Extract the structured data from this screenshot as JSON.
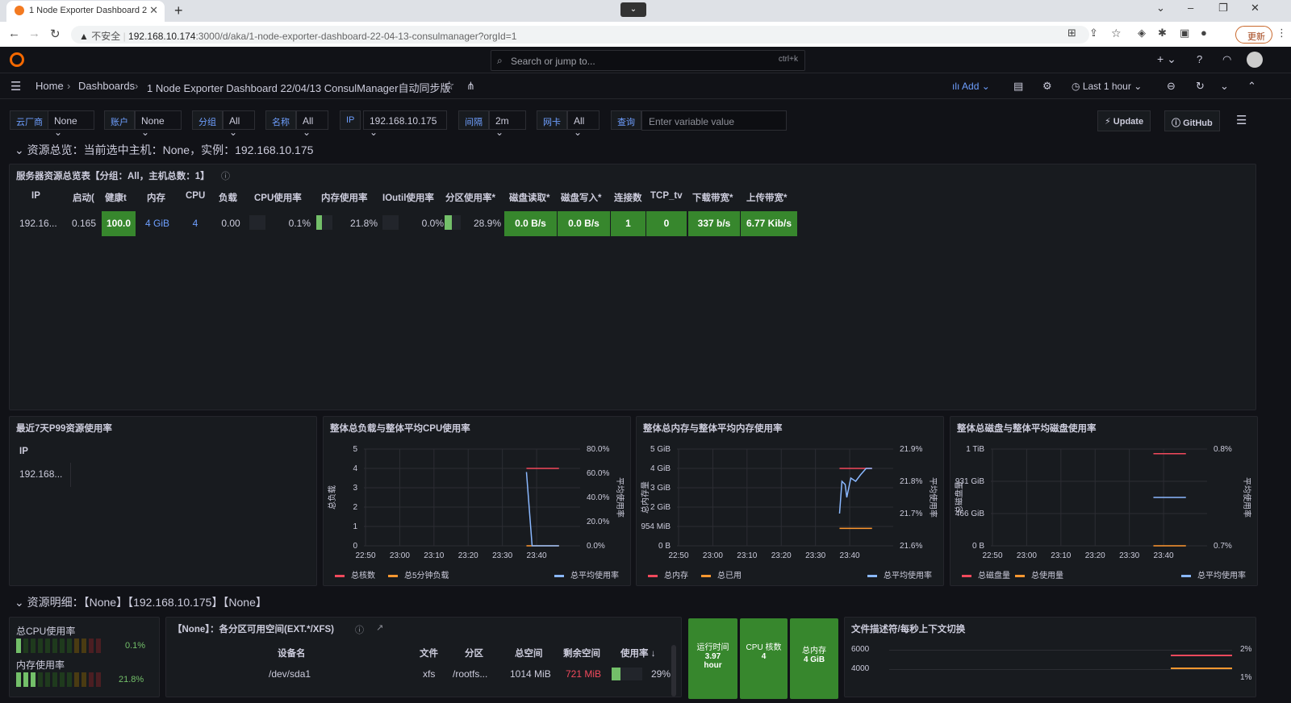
{
  "browser": {
    "tab_title": "1 Node Exporter Dashboard 2",
    "url_warning": "不安全",
    "url_host": "192.168.10.174",
    "url_rest": ":3000/d/aka/1-node-exporter-dashboard-22-04-13-consulmanager?orgId=1",
    "update_label": "更新"
  },
  "topbar": {
    "search_placeholder": "Search or jump to...",
    "shortcut": "ctrl+k"
  },
  "breadcrumb": {
    "home": "Home",
    "dashboards": "Dashboards",
    "title": "1 Node Exporter Dashboard 22/04/13 ConsulManager自动同步版"
  },
  "toolbar": {
    "add": "Add",
    "time_range": "Last 1 hour"
  },
  "variables": [
    {
      "label": "云厂商",
      "value": "None"
    },
    {
      "label": "账户",
      "value": "None"
    },
    {
      "label": "分组",
      "value": "All"
    },
    {
      "label": "名称",
      "value": "All"
    },
    {
      "label": "IP",
      "value": "192.168.10.175"
    },
    {
      "label": "间隔",
      "value": "2m"
    },
    {
      "label": "网卡",
      "value": "All"
    },
    {
      "label": "查询",
      "placeholder": "Enter variable value"
    }
  ],
  "buttons": {
    "update": "Update",
    "github": "GitHub"
  },
  "row1_title": "资源总览：当前选中主机：None，实例：192.168.10.175",
  "overview": {
    "title": "服务器资源总览表【分组：All，主机总数：1】",
    "headers": [
      "IP",
      "启动(",
      "健康t",
      "内存",
      "CPU",
      "负载",
      "CPU使用率",
      "内存使用率",
      "IOutil使用率",
      "分区使用率*",
      "磁盘读取*",
      "磁盘写入*",
      "连接数",
      "TCP_tv",
      "下载带宽*",
      "上传带宽*"
    ],
    "row": [
      "192.16...",
      "0.165",
      "100.0",
      "4 GiB",
      "4",
      "0.00",
      "0.1%",
      "21.8%",
      "0.0%",
      "28.9%",
      "0.0 B/s",
      "0.0 B/s",
      "1",
      "0",
      "337 b/s",
      "6.77 Kib/s"
    ]
  },
  "p99": {
    "title": "最近7天P99资源使用率",
    "col": "IP",
    "value": "192.168..."
  },
  "chart_data": [
    {
      "type": "line",
      "title": "整体总负载与整体平均CPU使用率",
      "ylabel": "总负载",
      "y2label": "平均使用率",
      "x": [
        "22:50",
        "23:00",
        "23:10",
        "23:20",
        "23:30",
        "23:40"
      ],
      "yticks": [
        "0",
        "1",
        "2",
        "3",
        "4",
        "5"
      ],
      "y2ticks": [
        "0.0%",
        "20.0%",
        "40.0%",
        "60.0%",
        "80.0%"
      ],
      "series": [
        {
          "name": "总核数",
          "color": "#f2495c",
          "values": [
            4,
            4
          ]
        },
        {
          "name": "总5分钟负载",
          "color": "#ff9830",
          "values": [
            0,
            0
          ]
        },
        {
          "name": "总平均使用率",
          "color": "#8ab8ff",
          "values": [
            61,
            0.1
          ]
        }
      ]
    },
    {
      "type": "line",
      "title": "整体总内存与整体平均内存使用率",
      "ylabel": "总内存量",
      "y2label": "平均使用率",
      "x": [
        "22:50",
        "23:00",
        "23:10",
        "23:20",
        "23:30",
        "23:40"
      ],
      "yticks": [
        "0 B",
        "954 MiB",
        "2 GiB",
        "3 GiB",
        "4 GiB",
        "5 GiB"
      ],
      "y2ticks": [
        "21.6%",
        "21.7%",
        "21.8%",
        "21.9%"
      ],
      "series": [
        {
          "name": "总内存",
          "color": "#f2495c",
          "values": [
            4,
            4
          ]
        },
        {
          "name": "总已用",
          "color": "#ff9830",
          "values": [
            0.9,
            0.9
          ]
        },
        {
          "name": "总平均使用率",
          "color": "#8ab8ff",
          "values": [
            21.7,
            21.82
          ]
        }
      ]
    },
    {
      "type": "line",
      "title": "整体总磁盘与整体平均磁盘使用率",
      "ylabel": "总磁盘量",
      "y2label": "平均使用率",
      "x": [
        "22:50",
        "23:00",
        "23:10",
        "23:20",
        "23:30",
        "23:40"
      ],
      "yticks": [
        "0 B",
        "466 GiB",
        "931 GiB",
        "1 TiB"
      ],
      "y2ticks": [
        "0.7%",
        "0.8%"
      ],
      "series": [
        {
          "name": "总磁盘量",
          "color": "#f2495c",
          "values": [
            1000,
            1000
          ]
        },
        {
          "name": "总使用量",
          "color": "#ff9830",
          "values": [
            0,
            0
          ]
        },
        {
          "name": "总平均使用率",
          "color": "#8ab8ff",
          "values": [
            0.75,
            0.75
          ]
        }
      ]
    }
  ],
  "row2_title": "资源明细：【None】【192.168.10.175】【None】",
  "detail": {
    "cpu_label": "总CPU使用率",
    "cpu_value": "0.1%",
    "mem_label": "内存使用率",
    "mem_value": "21.8%",
    "fs_title": "【None】：各分区可用空间(EXT.*/XFS)",
    "fs_headers": [
      "设备名",
      "文件",
      "分区",
      "总空间",
      "剩余空间",
      "使用率"
    ],
    "fs_row": [
      "/dev/sda1",
      "xfs",
      "/rootfs...",
      "1014 MiB",
      "721 MiB",
      "29%"
    ],
    "uptime_label": "运行时间",
    "uptime_value": "3.97",
    "uptime_unit": "hour",
    "cores_label": "CPU 核数",
    "cores_value": "4",
    "memtotal_label": "总内存",
    "memtotal_value": "4 GiB",
    "fd_title": "文件描述符/每秒上下文切换",
    "fd_yticks": [
      "6000",
      "4000"
    ],
    "fd_y2ticks": [
      "2%",
      "1%"
    ]
  }
}
